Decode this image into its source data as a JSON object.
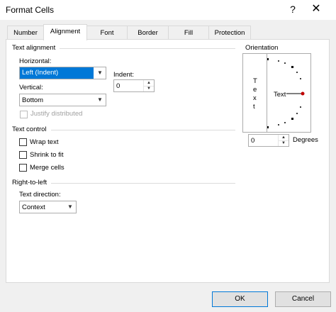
{
  "window": {
    "title": "Format Cells",
    "help_glyph": "?",
    "close_glyph": "✕"
  },
  "tabs": [
    "Number",
    "Alignment",
    "Font",
    "Border",
    "Fill",
    "Protection"
  ],
  "active_tab": "Alignment",
  "text_alignment": {
    "heading": "Text alignment",
    "horizontal_label": "Horizontal:",
    "horizontal_value": "Left (Indent)",
    "indent_label": "Indent:",
    "indent_value": "0",
    "vertical_label": "Vertical:",
    "vertical_value": "Bottom",
    "justify_distributed_label": "Justify distributed"
  },
  "text_control": {
    "heading": "Text control",
    "wrap_text_label": "Wrap text",
    "shrink_to_fit_label": "Shrink to fit",
    "merge_cells_label": "Merge cells"
  },
  "right_to_left": {
    "heading": "Right-to-left",
    "text_direction_label": "Text direction:",
    "text_direction_value": "Context"
  },
  "orientation": {
    "heading": "Orientation",
    "vertical_letters": [
      "T",
      "e",
      "x",
      "t"
    ],
    "dial_text": "Text",
    "degrees_value": "0",
    "degrees_label": "Degrees"
  },
  "footer": {
    "ok_label": "OK",
    "cancel_label": "Cancel"
  }
}
